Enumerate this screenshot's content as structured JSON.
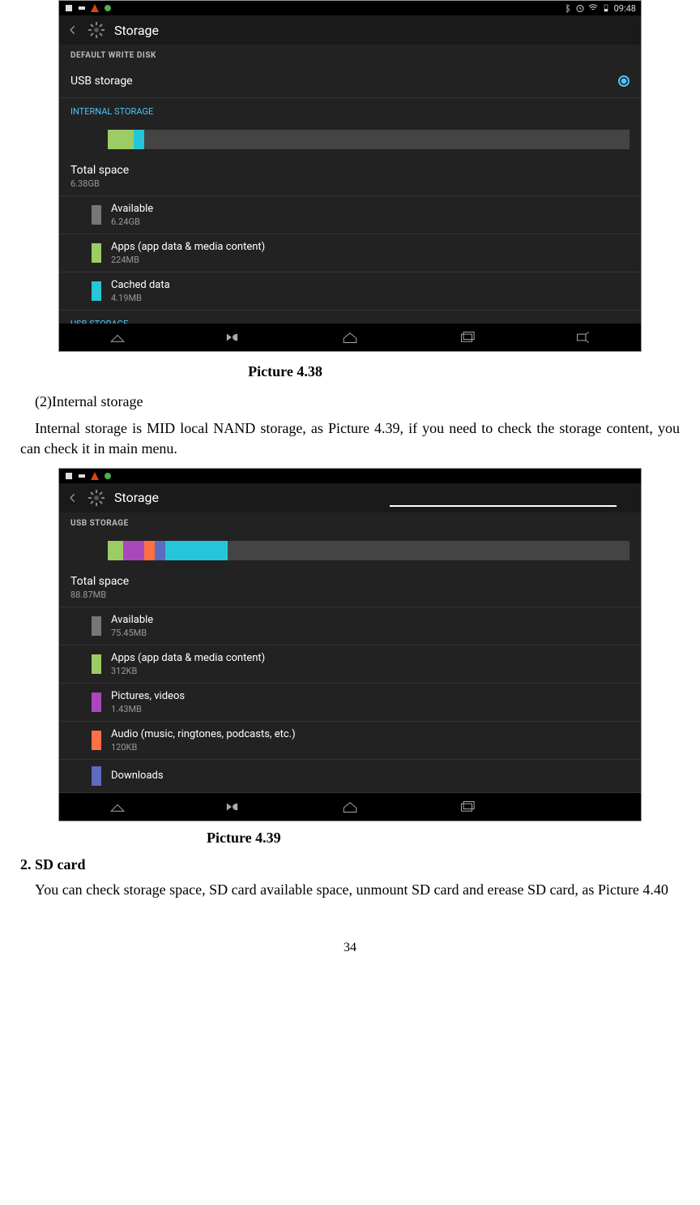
{
  "page_number": "34",
  "screenshot1": {
    "status_time": "09:48",
    "app_title": "Storage",
    "sections": {
      "default_disk_header": "DEFAULT WRITE DISK",
      "usb_storage_label": "USB storage",
      "internal_header": "INTERNAL STORAGE",
      "usb_cutoff": "USB STORAGE"
    },
    "bar_segments": [
      {
        "color": "#9ccc65",
        "width": "5%"
      },
      {
        "color": "#26c6da",
        "width": "2%"
      }
    ],
    "total": {
      "label": "Total space",
      "value": "6.38GB"
    },
    "categories": [
      {
        "color": "#777",
        "label": "Available",
        "value": "6.24GB"
      },
      {
        "color": "#9ccc65",
        "label": "Apps (app data & media content)",
        "value": "224MB"
      },
      {
        "color": "#26c6da",
        "label": "Cached data",
        "value": "4.19MB"
      }
    ]
  },
  "caption1": "Picture 4.38",
  "text_block1_heading": "(2)Internal storage",
  "text_block1_body": "Internal storage is MID local NAND storage, as Picture 4.39, if you need to check the storage content, you can check it in main menu.",
  "screenshot2": {
    "app_title": "Storage",
    "section_header": "USB STORAGE",
    "bar_segments": [
      {
        "color": "#9ccc65",
        "width": "3%"
      },
      {
        "color": "#ab47bc",
        "width": "4%"
      },
      {
        "color": "#ff7043",
        "width": "2%"
      },
      {
        "color": "#5c6bc0",
        "width": "2%"
      },
      {
        "color": "#26c6da",
        "width": "12%"
      }
    ],
    "total": {
      "label": "Total space",
      "value": "88.87MB"
    },
    "categories": [
      {
        "color": "#777",
        "label": "Available",
        "value": "75.45MB"
      },
      {
        "color": "#9ccc65",
        "label": "Apps (app data & media content)",
        "value": "312KB"
      },
      {
        "color": "#ab47bc",
        "label": "Pictures, videos",
        "value": "1.43MB"
      },
      {
        "color": "#ff7043",
        "label": "Audio (music, ringtones, podcasts, etc.)",
        "value": "120KB"
      },
      {
        "color": "#5c6bc0",
        "label": "Downloads",
        "value": ""
      }
    ]
  },
  "caption2": "Picture 4.39",
  "heading2": "2.    SD card",
  "text_block2": "You can check storage space, SD card available space, unmount SD card and erease SD card, as Picture 4.40"
}
